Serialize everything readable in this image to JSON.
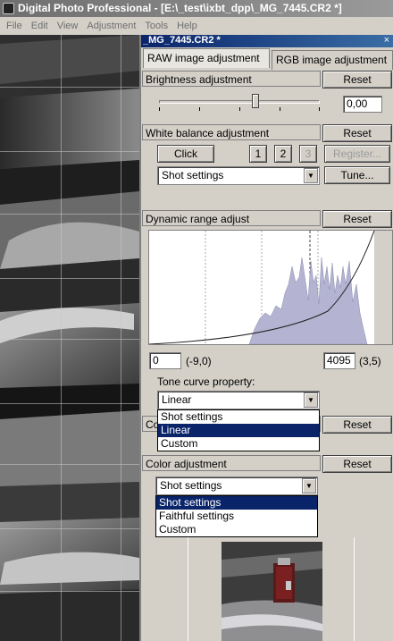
{
  "window": {
    "title": "Digital Photo Professional - [E:\\_test\\ixbt_dpp\\_MG_7445.CR2 *]",
    "menus": [
      "File",
      "Edit",
      "View",
      "Adjustment",
      "Tools",
      "Help"
    ]
  },
  "palette": {
    "title": "_MG_7445.CR2 *",
    "close_glyph": "×",
    "tabs": [
      {
        "label": "RAW image adjustment",
        "active": true
      },
      {
        "label": "RGB image adjustment",
        "active": false
      }
    ],
    "brightness": {
      "header": "Brightness adjustment",
      "reset": "Reset",
      "value": "0,00",
      "slider_fraction": 0.6
    },
    "white_balance": {
      "header": "White balance adjustment",
      "reset": "Reset",
      "click": "Click",
      "presets": [
        "1",
        "2",
        "3"
      ],
      "register": "Register...",
      "select_value": "Shot settings",
      "tune": "Tune..."
    },
    "dynamic_range": {
      "header": "Dynamic range adjust",
      "reset": "Reset",
      "min_value": "0",
      "min_ev": "(-9,0)",
      "max_value": "4095",
      "max_ev": "(3,5)"
    },
    "tone_curve": {
      "label": "Tone curve property:",
      "value": "Linear",
      "options": [
        "Shot settings",
        "Linear",
        "Custom"
      ],
      "selected_index": 1,
      "hidden_header_fragment": "Co",
      "reset": "Reset"
    },
    "color_adjustment": {
      "header": "Color adjustment",
      "reset": "Reset",
      "value": "Shot settings",
      "options": [
        "Shot settings",
        "Faithful settings",
        "Custom"
      ],
      "selected_index": 0
    },
    "colors": {
      "title_bar": "#0a246a",
      "selection": "#0a246a",
      "histogram_fill": "#b4b4d2",
      "face": "#d4d0c8"
    }
  }
}
